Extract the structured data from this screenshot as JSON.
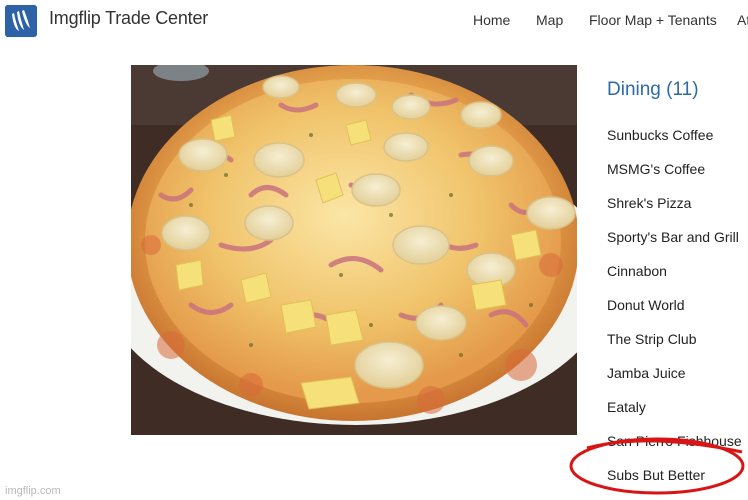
{
  "header": {
    "title": "Imgflip Trade Center",
    "logo_icon": "imgflip-logo-icon",
    "nav": [
      {
        "label": "Home"
      },
      {
        "label": "Map"
      },
      {
        "label": "Floor Map + Tenants"
      },
      {
        "label": "At"
      }
    ]
  },
  "main": {
    "image_subject": "pizza topped with ham, banana slices and pineapple"
  },
  "sidebar": {
    "heading": "Dining (11)",
    "items": [
      {
        "label": "Sunbucks Coffee"
      },
      {
        "label": "MSMG's Coffee"
      },
      {
        "label": "Shrek's Pizza"
      },
      {
        "label": "Sporty's Bar and Grill"
      },
      {
        "label": "Cinnabon"
      },
      {
        "label": "Donut World"
      },
      {
        "label": "The Strip Club"
      },
      {
        "label": "Jamba Juice"
      },
      {
        "label": "Eataly"
      },
      {
        "label": "San Pierro Fishhouse"
      },
      {
        "label": "Subs But Better"
      }
    ]
  },
  "annotation": {
    "color": "#d91414"
  },
  "watermark": "imgflip.com",
  "colors": {
    "heading": "#2c6aa8",
    "logo": "#2d63a6",
    "text": "#222222"
  }
}
